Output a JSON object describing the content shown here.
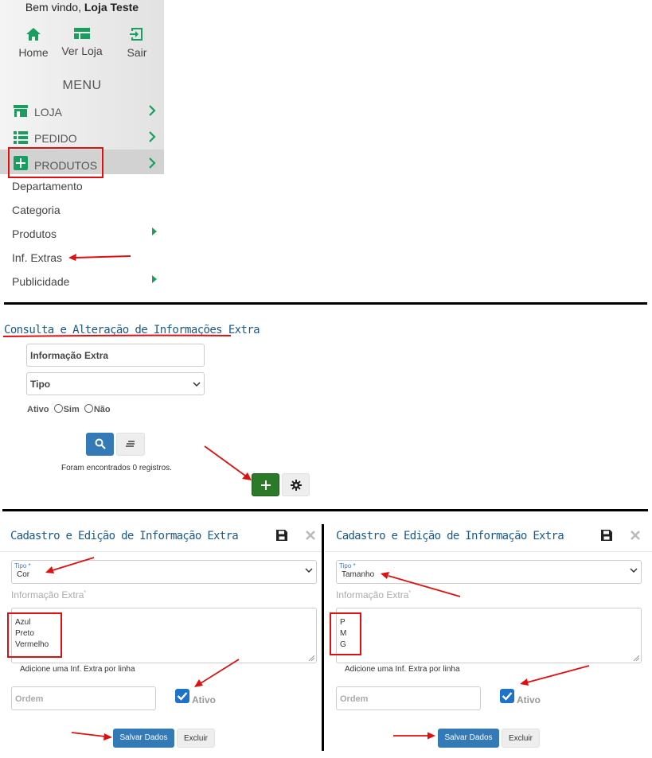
{
  "sidebar": {
    "welcome_prefix": "Bem vindo,",
    "welcome_user": "Loja Teste",
    "quick_links": {
      "home": "Home",
      "ver_loja": "Ver Loja",
      "sair": "Sair"
    },
    "menu_title": "MENU",
    "menu_items": [
      {
        "label": "LOJA",
        "icon": "store-icon"
      },
      {
        "label": "PEDIDO",
        "icon": "list-icon"
      },
      {
        "label": "PRODUTOS",
        "icon": "plus-square-icon"
      }
    ],
    "sub_items": [
      {
        "label": "Departamento"
      },
      {
        "label": "Categoria"
      },
      {
        "label": "Produtos"
      },
      {
        "label": "Inf. Extras"
      },
      {
        "label": "Publicidade"
      }
    ]
  },
  "consulta": {
    "title": "Consulta e Alteração de Informações Extra",
    "info_placeholder": "Informação Extra",
    "tipo_placeholder": "Tipo",
    "ativo_label": "Ativo",
    "sim_label": "Sim",
    "nao_label": "Não",
    "result_text": "Foram encontrados 0 registros."
  },
  "modals": [
    {
      "title": "Cadastro e Edição de Informação Extra",
      "tipo_label": "Tipo",
      "tipo_required": "*",
      "tipo_value": "Cor",
      "info_label": "Informação Extra",
      "info_required": "*",
      "lines": [
        "Azul",
        "Preto",
        "Vermelho"
      ],
      "helper": "Adicione uma Inf. Extra por linha",
      "ordem_placeholder": "Ordem",
      "ativo_label": "Ativo",
      "save_label": "Salvar Dados",
      "delete_label": "Excluir"
    },
    {
      "title": "Cadastro e Edição de Informação Extra",
      "tipo_label": "Tipo",
      "tipo_required": "*",
      "tipo_value": "Tamanho",
      "info_label": "Informação Extra",
      "info_required": "*",
      "lines": [
        "P",
        "M",
        "G"
      ],
      "helper": "Adicione uma Inf. Extra por linha",
      "ordem_placeholder": "Ordem",
      "ativo_label": "Ativo",
      "save_label": "Salvar Dados",
      "delete_label": "Excluir"
    }
  ],
  "colors": {
    "accent_green": "#1a9e5f",
    "add_button": "#2a7a2a",
    "primary_blue": "#337ab7",
    "annotation_red": "#e01010"
  }
}
